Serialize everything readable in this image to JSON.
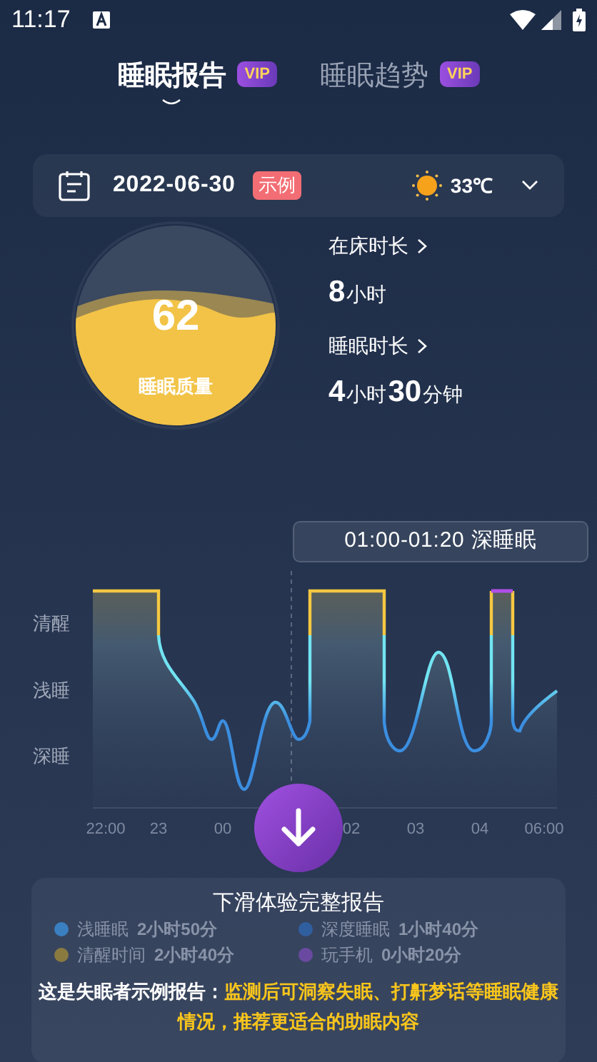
{
  "status_bar": {
    "time": "11:17"
  },
  "tabs": [
    {
      "label": "睡眠报告",
      "badge": "VIP",
      "selected": true
    },
    {
      "label": "睡眠趋势",
      "badge": "VIP",
      "selected": false
    }
  ],
  "date_bar": {
    "date": "2022-06-30",
    "tag": "示例",
    "temperature": "33℃"
  },
  "score": {
    "value": "62",
    "label": "睡眠质量"
  },
  "stats": [
    {
      "title": "在床时长",
      "parts": [
        {
          "text": "8",
          "kind": "number"
        },
        {
          "text": "小时",
          "kind": "unit"
        }
      ]
    },
    {
      "title": "睡眠时长",
      "parts": [
        {
          "text": "4",
          "kind": "number"
        },
        {
          "text": "小时",
          "kind": "unit"
        },
        {
          "text": "30",
          "kind": "number"
        },
        {
          "text": "分钟",
          "kind": "unit"
        }
      ]
    }
  ],
  "tooltip": "01:00-01:20 深睡眠",
  "chart": {
    "y_labels": [
      "清醒",
      "浅睡",
      "深睡"
    ],
    "x_labels": [
      "22:00",
      "23",
      "00",
      "02",
      "03",
      "04",
      "06:00"
    ]
  },
  "legend": [
    {
      "name": "浅睡眠",
      "value": "2小时50分",
      "color": "#3a7fc0"
    },
    {
      "name": "深度睡眠",
      "value": "1小时40分",
      "color": "#2f5f9f"
    },
    {
      "name": "清醒时间",
      "value": "2小时40分",
      "color": "#8a7a40"
    },
    {
      "name": "玩手机",
      "value": "0小时20分",
      "color": "#6a4aa0"
    }
  ],
  "prompt": "下滑体验完整报告",
  "notice": {
    "lead": "这是失眠者示例报告：",
    "body": "监测后可洞察失眠、打鼾梦话等睡眠健康情况，推荐更适合的助眠内容"
  }
}
